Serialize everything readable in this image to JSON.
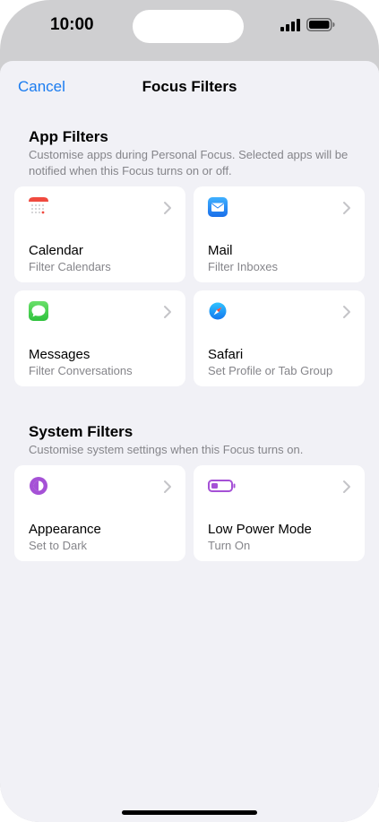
{
  "status": {
    "time": "10:00"
  },
  "nav": {
    "cancel_label": "Cancel",
    "title": "Focus Filters"
  },
  "app_filters": {
    "title": "App Filters",
    "description": "Customise apps during Personal Focus. Selected apps will be notified when this Focus turns on or off.",
    "items": [
      {
        "title": "Calendar",
        "subtitle": "Filter Calendars",
        "icon": "calendar-icon"
      },
      {
        "title": "Mail",
        "subtitle": "Filter Inboxes",
        "icon": "mail-icon"
      },
      {
        "title": "Messages",
        "subtitle": "Filter Conversations",
        "icon": "messages-icon"
      },
      {
        "title": "Safari",
        "subtitle": "Set Profile or Tab Group",
        "icon": "safari-icon"
      }
    ]
  },
  "system_filters": {
    "title": "System Filters",
    "description": "Customise system settings when this Focus turns on.",
    "items": [
      {
        "title": "Appearance",
        "subtitle": "Set to Dark",
        "icon": "appearance-icon"
      },
      {
        "title": "Low Power Mode",
        "subtitle": "Turn On",
        "icon": "battery-icon"
      }
    ]
  },
  "colors": {
    "accent": "#1a7cf0",
    "sheet_bg": "#f1f1f6",
    "secondary_text": "#85858a",
    "purple": "#a551d6"
  }
}
